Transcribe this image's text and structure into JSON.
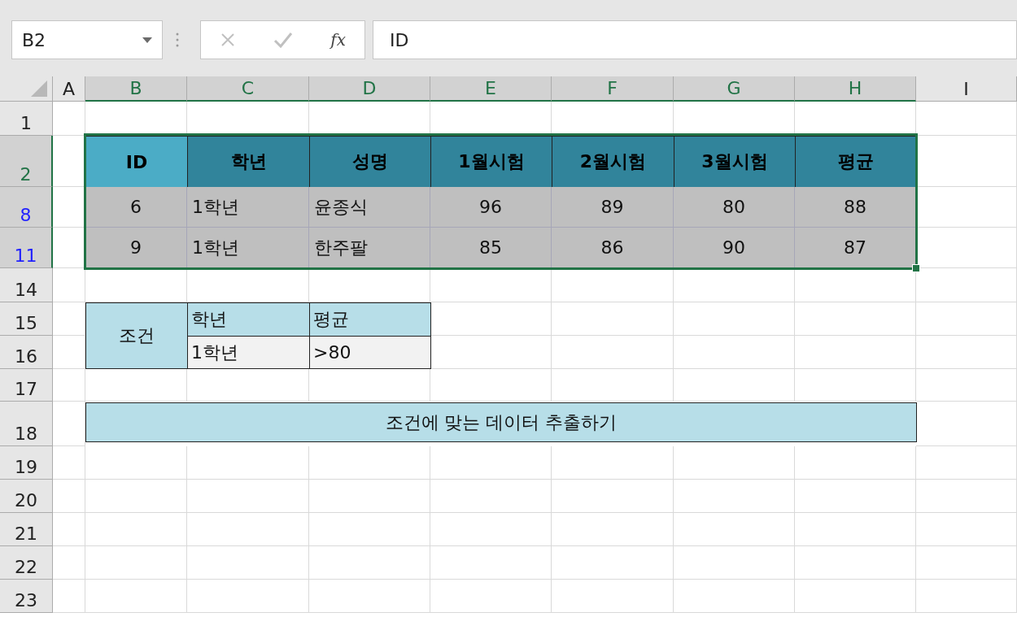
{
  "formula_bar": {
    "name_box": "B2",
    "function_label": "fx",
    "formula": "ID"
  },
  "columns": [
    {
      "label": "A",
      "selected": false
    },
    {
      "label": "B",
      "selected": true
    },
    {
      "label": "C",
      "selected": true
    },
    {
      "label": "D",
      "selected": true
    },
    {
      "label": "E",
      "selected": true
    },
    {
      "label": "F",
      "selected": true
    },
    {
      "label": "G",
      "selected": true
    },
    {
      "label": "H",
      "selected": true
    },
    {
      "label": "I",
      "selected": false
    }
  ],
  "rows": [
    {
      "label": "1",
      "selected": false,
      "filtered": false
    },
    {
      "label": "2",
      "selected": true,
      "filtered": false
    },
    {
      "label": "8",
      "selected": true,
      "filtered": true
    },
    {
      "label": "11",
      "selected": true,
      "filtered": true
    },
    {
      "label": "14",
      "selected": false,
      "filtered": false
    },
    {
      "label": "15",
      "selected": false,
      "filtered": false
    },
    {
      "label": "16",
      "selected": false,
      "filtered": false
    },
    {
      "label": "17",
      "selected": false,
      "filtered": false
    },
    {
      "label": "18",
      "selected": false,
      "filtered": false
    },
    {
      "label": "19",
      "selected": false,
      "filtered": false
    },
    {
      "label": "20",
      "selected": false,
      "filtered": false
    },
    {
      "label": "21",
      "selected": false,
      "filtered": false
    },
    {
      "label": "22",
      "selected": false,
      "filtered": false
    },
    {
      "label": "23",
      "selected": false,
      "filtered": false
    }
  ],
  "table": {
    "columns": [
      "ID",
      "학년",
      "성명",
      "1월시험",
      "2월시험",
      "3월시험",
      "평균"
    ],
    "rows": [
      [
        "6",
        "1학년",
        "윤종식",
        "96",
        "89",
        "80",
        "88"
      ],
      [
        "9",
        "1학년",
        "한주팔",
        "85",
        "86",
        "90",
        "87"
      ]
    ]
  },
  "criteria": {
    "title": "조건",
    "headers": [
      "학년",
      "평균"
    ],
    "values": [
      "1학년",
      ">80"
    ]
  },
  "action_button": "조건에 맞는 데이터 추출하기"
}
